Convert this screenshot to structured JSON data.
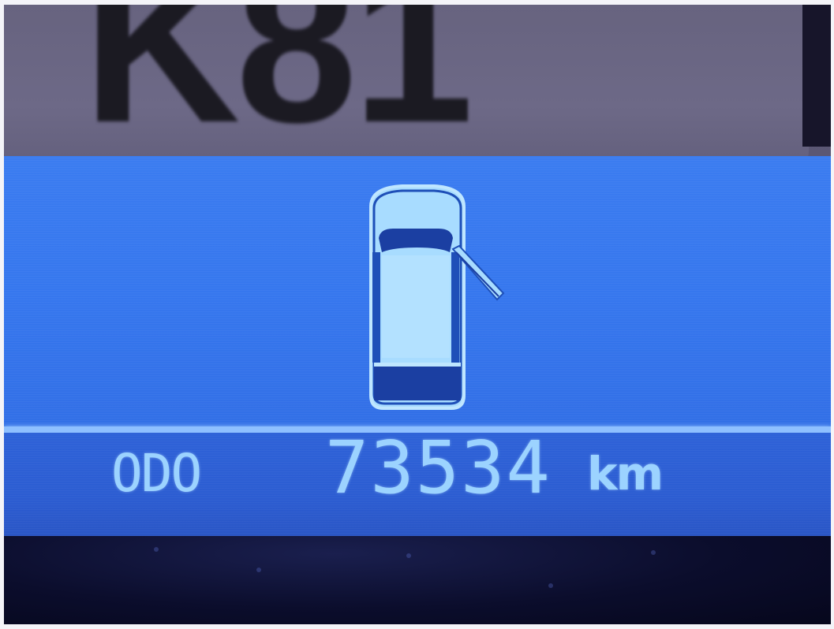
{
  "sticker": {
    "text": "K81"
  },
  "display": {
    "icon": "car-door-open-icon",
    "odo_label": "ODO",
    "odo_value": "73534",
    "odo_unit": "km"
  },
  "colors": {
    "lcd_background": "#3677ee",
    "lcd_segment": "#9cd3ff",
    "bezel": "#67637f"
  }
}
